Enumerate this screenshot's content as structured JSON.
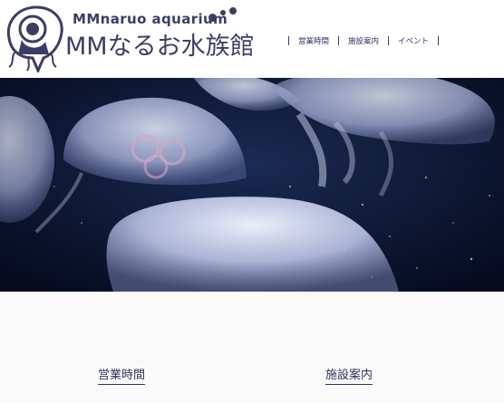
{
  "header": {
    "logo_en": "MMnaruo aquarium",
    "logo_jp": "MMなるお水族館",
    "nav": [
      {
        "label": "営業時間"
      },
      {
        "label": "施設案内"
      },
      {
        "label": "イベント"
      }
    ]
  },
  "hero": {
    "subject": "jellyfish",
    "background_color": "#0b1430"
  },
  "sections": [
    {
      "label": "営業時間"
    },
    {
      "label": "施設案内"
    }
  ],
  "colors": {
    "brand": "#3a3e66",
    "text": "#2f3361",
    "background": "#ffffff",
    "lower_background": "#fafafa"
  }
}
